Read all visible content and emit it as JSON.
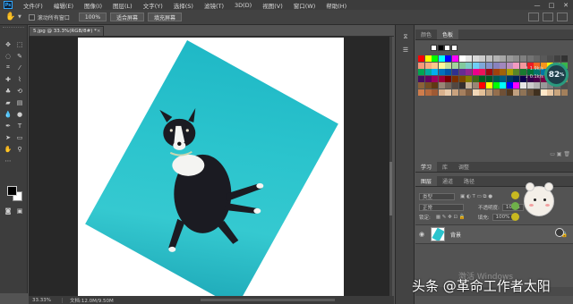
{
  "app": {
    "logo": "Ps"
  },
  "menu": [
    "文件(F)",
    "编辑(E)",
    "图像(I)",
    "图层(L)",
    "文字(Y)",
    "选择(S)",
    "滤镜(T)",
    "3D(D)",
    "视图(V)",
    "窗口(W)",
    "帮助(H)"
  ],
  "window_controls": {
    "minimize": "—",
    "maximize": "□",
    "close": "✕"
  },
  "options_bar": {
    "scroll_all_windows": "滚动所有窗口",
    "zoom_value": "100%",
    "fit_screen": "适合屏幕",
    "fill_screen": "填充屏幕"
  },
  "document": {
    "tab_title": "5.jpg @ 33.3%(RGB/8#) *",
    "tab_close": "×"
  },
  "status": {
    "zoom": "33.33%",
    "doc_size": "文档:12.0M/9.50M"
  },
  "swatches_panel": {
    "tabs": [
      "颜色",
      "色板"
    ],
    "active_tab": 1
  },
  "layers_panel": {
    "tabs": [
      "学习",
      "库",
      "调整"
    ],
    "sub_tabs": [
      "图层",
      "通道",
      "路径"
    ],
    "kind_filter": "类型",
    "blend_mode": "正常",
    "opacity_label": "不透明度:",
    "opacity_value": "100%",
    "lock_label": "锁定:",
    "fill_label": "填充:",
    "fill_value": "100%",
    "layer_name": "背景",
    "layer_lock": "🔒"
  },
  "overlay": {
    "gauge_value": "82",
    "gauge_unit": "%",
    "upload": "↑ 1.9k/s",
    "download": "↓ 0.1k/s",
    "windows_watermark": "激活 Windows",
    "attribution": "头条 @革命工作者太阳"
  },
  "colors": {
    "swatch_row1": [
      "#ffffff",
      "#000000",
      "#ffffff",
      "#ffffff"
    ],
    "swatch_rows": [
      [
        "#ff0000",
        "#ffff00",
        "#00ff00",
        "#00ffff",
        "#0000ff",
        "#ff00ff",
        "#ffffff",
        "#e6e6e6",
        "#d9d9d9",
        "#cccccc",
        "#bfbfbf",
        "#b3b3b3",
        "#a6a6a6",
        "#999999",
        "#8c8c8c",
        "#808080",
        "#737373",
        "#666666",
        "#595959",
        "#4d4d4d",
        "#404040",
        "#333333"
      ],
      [
        "#f7977a",
        "#f9ad81",
        "#fdc68a",
        "#fff79a",
        "#c4df9b",
        "#a3d39c",
        "#82ca9d",
        "#7bcdc8",
        "#6ecff6",
        "#7ea7d8",
        "#8493ca",
        "#8882be",
        "#a187be",
        "#bc8dbf",
        "#f49ac2",
        "#f6989d",
        "#ed1c24",
        "#f26522",
        "#f7941d",
        "#fff200",
        "#8dc63f",
        "#39b54a"
      ],
      [
        "#00a651",
        "#00a99d",
        "#00aeef",
        "#0072bc",
        "#0054a6",
        "#2e3192",
        "#662d91",
        "#92278f",
        "#ec008c",
        "#ed145b",
        "#9e0b0f",
        "#a0410d",
        "#a3620a",
        "#aba000",
        "#598527",
        "#1a7b30",
        "#007236",
        "#00746b",
        "#0076a3",
        "#004b80",
        "#003471",
        "#1b1464"
      ],
      [
        "#440e62",
        "#630460",
        "#9e005d",
        "#9e0039",
        "#790000",
        "#7b2e00",
        "#7d4900",
        "#827b00",
        "#406618",
        "#005e20",
        "#005826",
        "#005952",
        "#005b7f",
        "#003663",
        "#002157",
        "#0d004c",
        "#32004b",
        "#4b0049",
        "#7b0046",
        "#7a0026",
        "#c69c6d",
        "#a67c52"
      ],
      [
        "#8c6239",
        "#754c24",
        "#603913",
        "#998675",
        "#736357",
        "#534741",
        "#362f2d",
        "#c7b299",
        "#998675",
        "#ff0000",
        "#ffff00",
        "#00ff00",
        "#00ffff",
        "#0000ff",
        "#ff00ff",
        "#e6e6e6",
        "#cccccc",
        "#b3b3b3",
        "#999999",
        "#808080",
        "#666666",
        "#4d4d4d"
      ],
      [
        "#cf7d4c",
        "#b66a3e",
        "#9f5a34",
        "#d8b08c",
        "#e7c9a9",
        "#c9a27e",
        "#a57f5e",
        "#7d5c41",
        "#f1d7b8",
        "#e2bf97",
        "#bb9a75",
        "#946f4e",
        "#6f5036",
        "#52391f",
        "#c0a080",
        "#8f7356",
        "#66503a",
        "#40301f",
        "#ffe7c9",
        "#e8c7a2",
        "#c9a57d",
        "#a3805c"
      ]
    ]
  }
}
